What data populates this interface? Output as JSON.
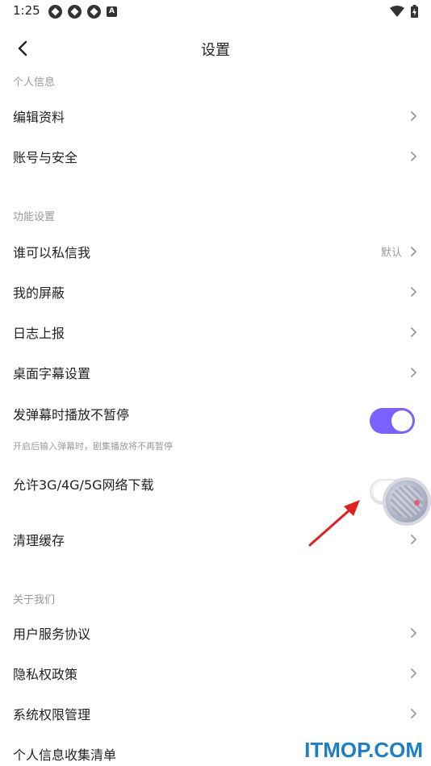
{
  "status_bar": {
    "time": "1:25",
    "badge_letter": "A"
  },
  "header": {
    "title": "设置"
  },
  "sections": {
    "personal": {
      "title": "个人信息",
      "items": [
        {
          "label": "编辑资料"
        },
        {
          "label": "账号与安全"
        }
      ]
    },
    "features": {
      "title": "功能设置",
      "items": [
        {
          "label": "谁可以私信我",
          "value": "默认"
        },
        {
          "label": "我的屏蔽"
        },
        {
          "label": "日志上报"
        },
        {
          "label": "桌面字幕设置"
        }
      ],
      "danmaku_toggle": {
        "label": "发弹幕时播放不暂停",
        "subtitle": "开启后输入弹幕时，剧集播放将不再暂停",
        "on": true
      },
      "mobile_download_toggle": {
        "label": "允许3G/4G/5G网络下载",
        "on": false
      },
      "clear_cache": {
        "label": "清理缓存"
      }
    },
    "about": {
      "title": "关于我们",
      "items": [
        {
          "label": "用户服务协议"
        },
        {
          "label": "隐私权政策"
        },
        {
          "label": "系统权限管理"
        },
        {
          "label": "个人信息收集清单"
        }
      ]
    }
  },
  "watermark": "ITMOP.COM",
  "colors": {
    "accent": "#7b61ff",
    "arrow": "#e02020",
    "watermark": "#1e7fc4"
  }
}
